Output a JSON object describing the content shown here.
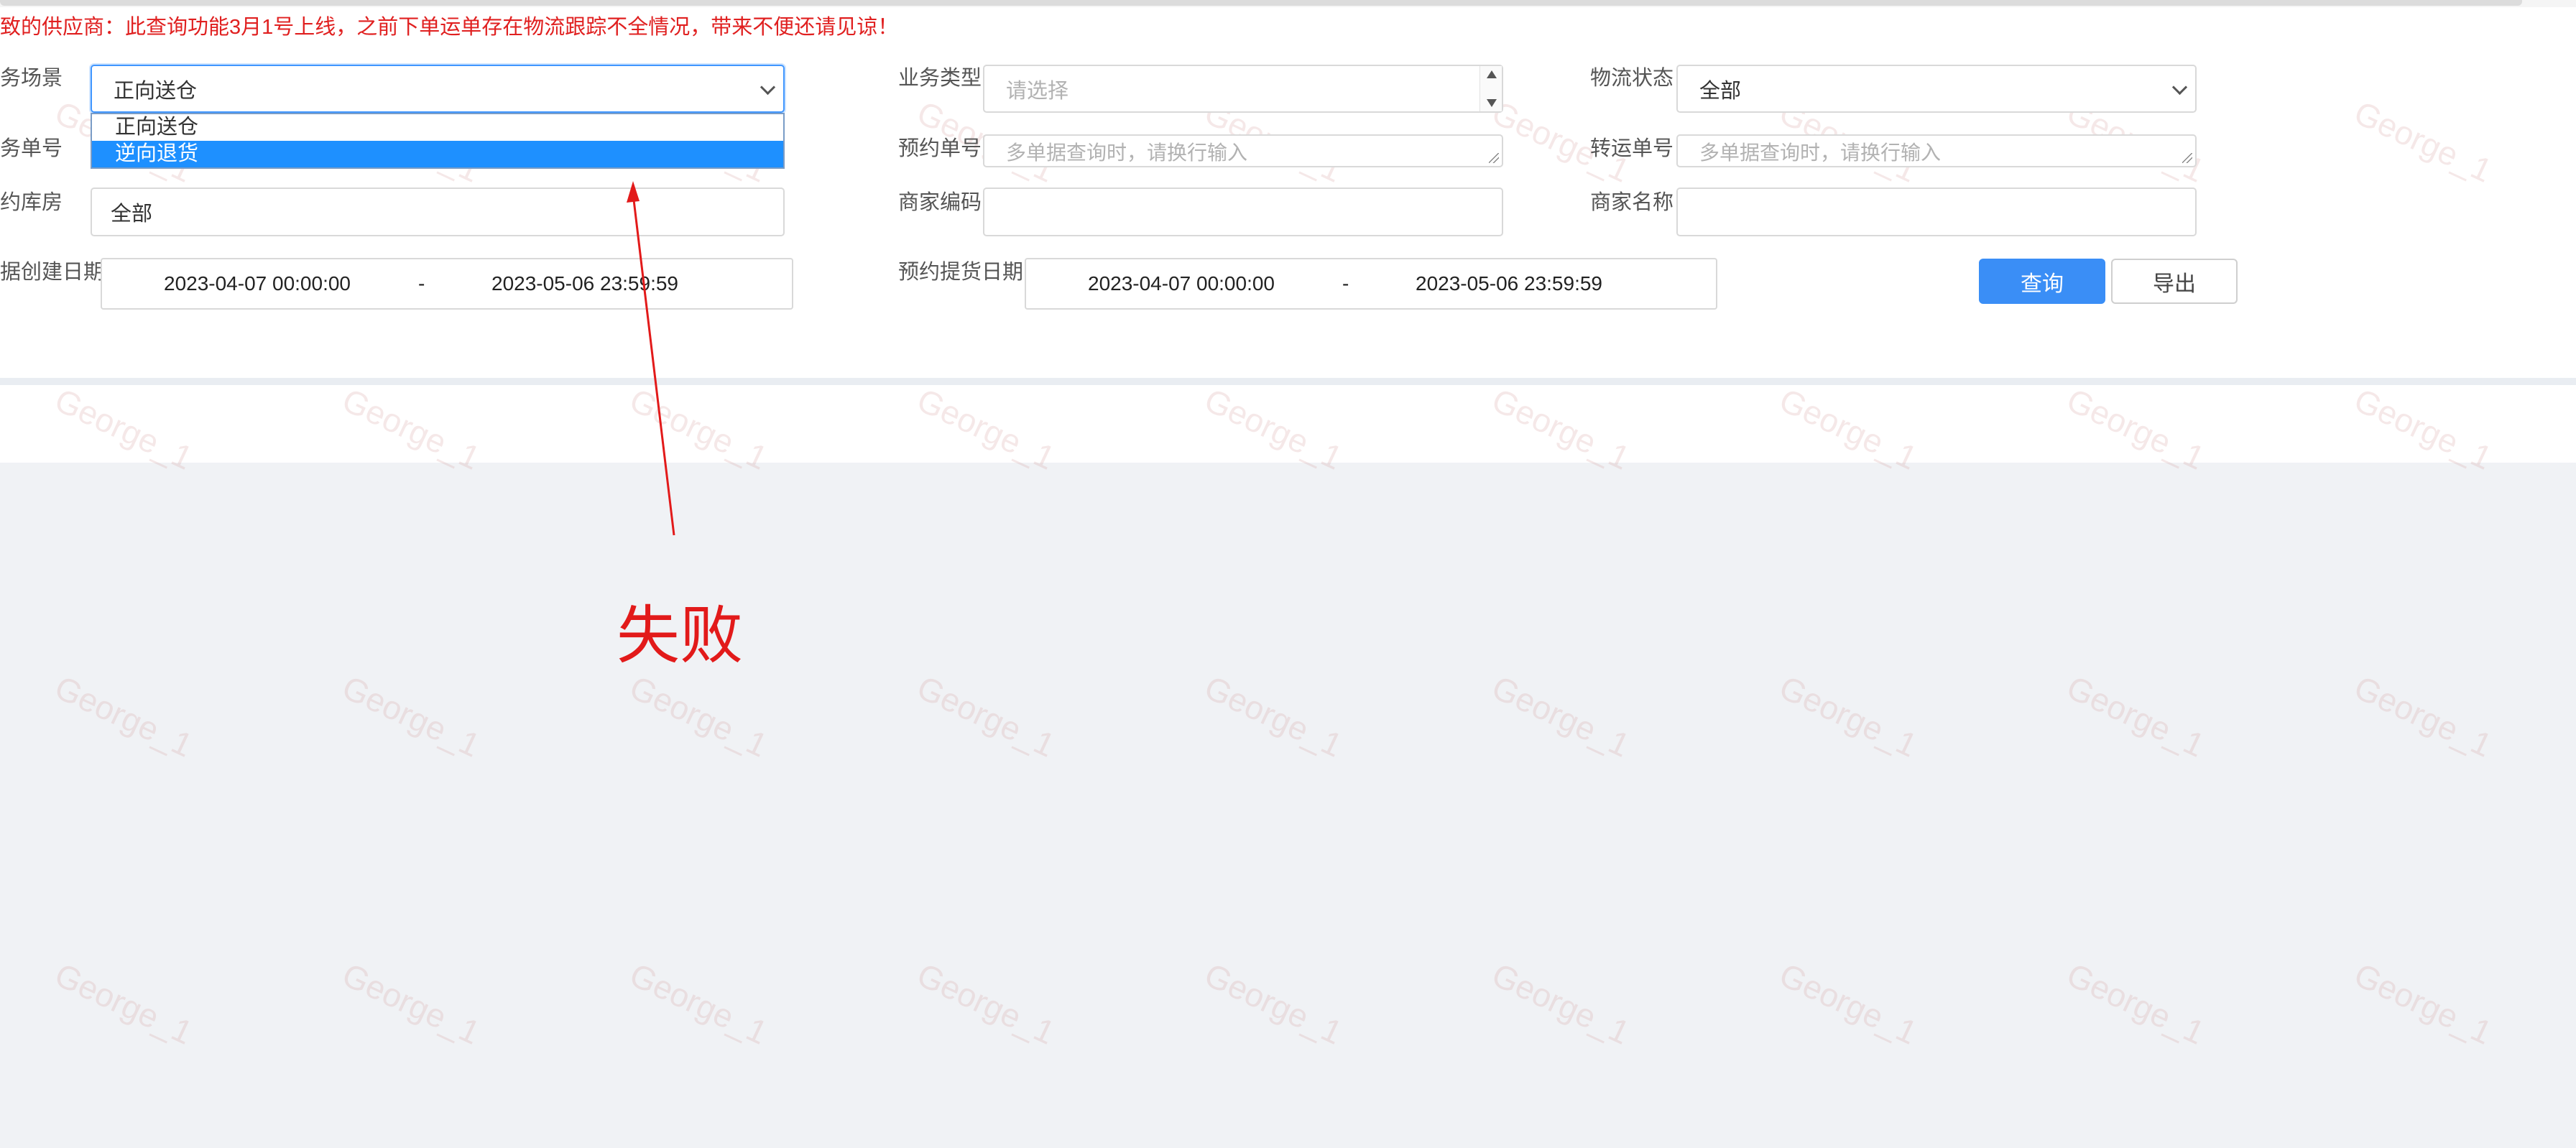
{
  "notice": "致的供应商：此查询功能3月1号上线，之前下单运单存在物流跟踪不全情况，带来不便还请见谅！",
  "form": {
    "scene": {
      "label": "务场景",
      "value": "正向送仓",
      "options": [
        "正向送仓",
        "逆向退货"
      ],
      "highlighted_option": "逆向退货"
    },
    "biz_type": {
      "label": "业务类型",
      "placeholder": "请选择"
    },
    "logistics_status": {
      "label": "物流状态",
      "value": "全部"
    },
    "biz_no": {
      "label": "务单号"
    },
    "appointment_no": {
      "label": "预约单号",
      "placeholder": "多单据查询时，请换行输入"
    },
    "transfer_no": {
      "label": "转运单号",
      "placeholder": "多单据查询时，请换行输入"
    },
    "warehouse": {
      "label": "约库房",
      "value": "全部"
    },
    "merchant_code": {
      "label": "商家编码",
      "value": ""
    },
    "merchant_name": {
      "label": "商家名称",
      "value": ""
    },
    "created_date": {
      "label": "据创建日期",
      "start": "2023-04-07 00:00:00",
      "separator": "-",
      "end": "2023-05-06 23:59:59"
    },
    "pickup_date": {
      "label": "预约提货日期",
      "start": "2023-04-07 00:00:00",
      "separator": "-",
      "end": "2023-05-06 23:59:59"
    }
  },
  "buttons": {
    "query": "查询",
    "export": "导出"
  },
  "annotation": {
    "text": "失败",
    "color": "#e21a1a"
  },
  "watermark": "George_1",
  "colors": {
    "primary": "#3a8ef6",
    "notice": "#e02020",
    "focus": "#4096ff",
    "option_selected": "#1e90ff"
  }
}
